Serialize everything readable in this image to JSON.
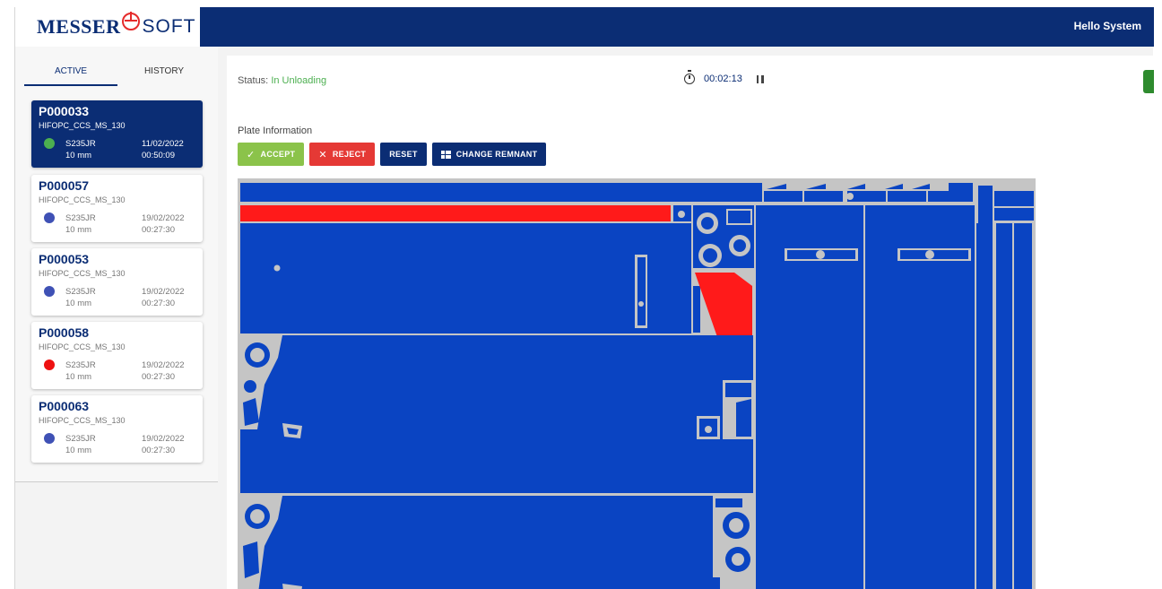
{
  "header": {
    "logo_main": "MESSER",
    "logo_sub": "SOFT",
    "greeting": "Hello System"
  },
  "sidebar": {
    "tabs": [
      {
        "label": "ACTIVE",
        "active": true
      },
      {
        "label": "HISTORY",
        "active": false
      }
    ],
    "jobs": [
      {
        "id": "P000033",
        "program": "HIFOPC_CCS_MS_130",
        "material": "S235JR",
        "thickness": "10 mm",
        "date": "11/02/2022",
        "time": "00:50:09",
        "status_color": "#4caf50",
        "selected": true
      },
      {
        "id": "P000057",
        "program": "HIFOPC_CCS_MS_130",
        "material": "S235JR",
        "thickness": "10 mm",
        "date": "19/02/2022",
        "time": "00:27:30",
        "status_color": "#3f51b5",
        "selected": false
      },
      {
        "id": "P000053",
        "program": "HIFOPC_CCS_MS_130",
        "material": "S235JR",
        "thickness": "10 mm",
        "date": "19/02/2022",
        "time": "00:27:30",
        "status_color": "#3f51b5",
        "selected": false
      },
      {
        "id": "P000058",
        "program": "HIFOPC_CCS_MS_130",
        "material": "S235JR",
        "thickness": "10 mm",
        "date": "19/02/2022",
        "time": "00:27:30",
        "status_color": "#ee1111",
        "selected": false
      },
      {
        "id": "P000063",
        "program": "HIFOPC_CCS_MS_130",
        "material": "S235JR",
        "thickness": "10 mm",
        "date": "19/02/2022",
        "time": "00:27:30",
        "status_color": "#3f51b5",
        "selected": false
      }
    ]
  },
  "main": {
    "status_label": "Status:",
    "status_value": "In Unloading",
    "timer": "00:02:13",
    "plate_title": "Plate Information",
    "buttons": {
      "accept": "ACCEPT",
      "reject": "REJECT",
      "reset": "RESET",
      "change_remnant": "CHANGE REMNANT"
    }
  },
  "colors": {
    "nav": "#0b2d74",
    "part": "#0a44c2",
    "part_rejected": "#ff1a1a",
    "plate_bg": "#c5c5c5"
  }
}
